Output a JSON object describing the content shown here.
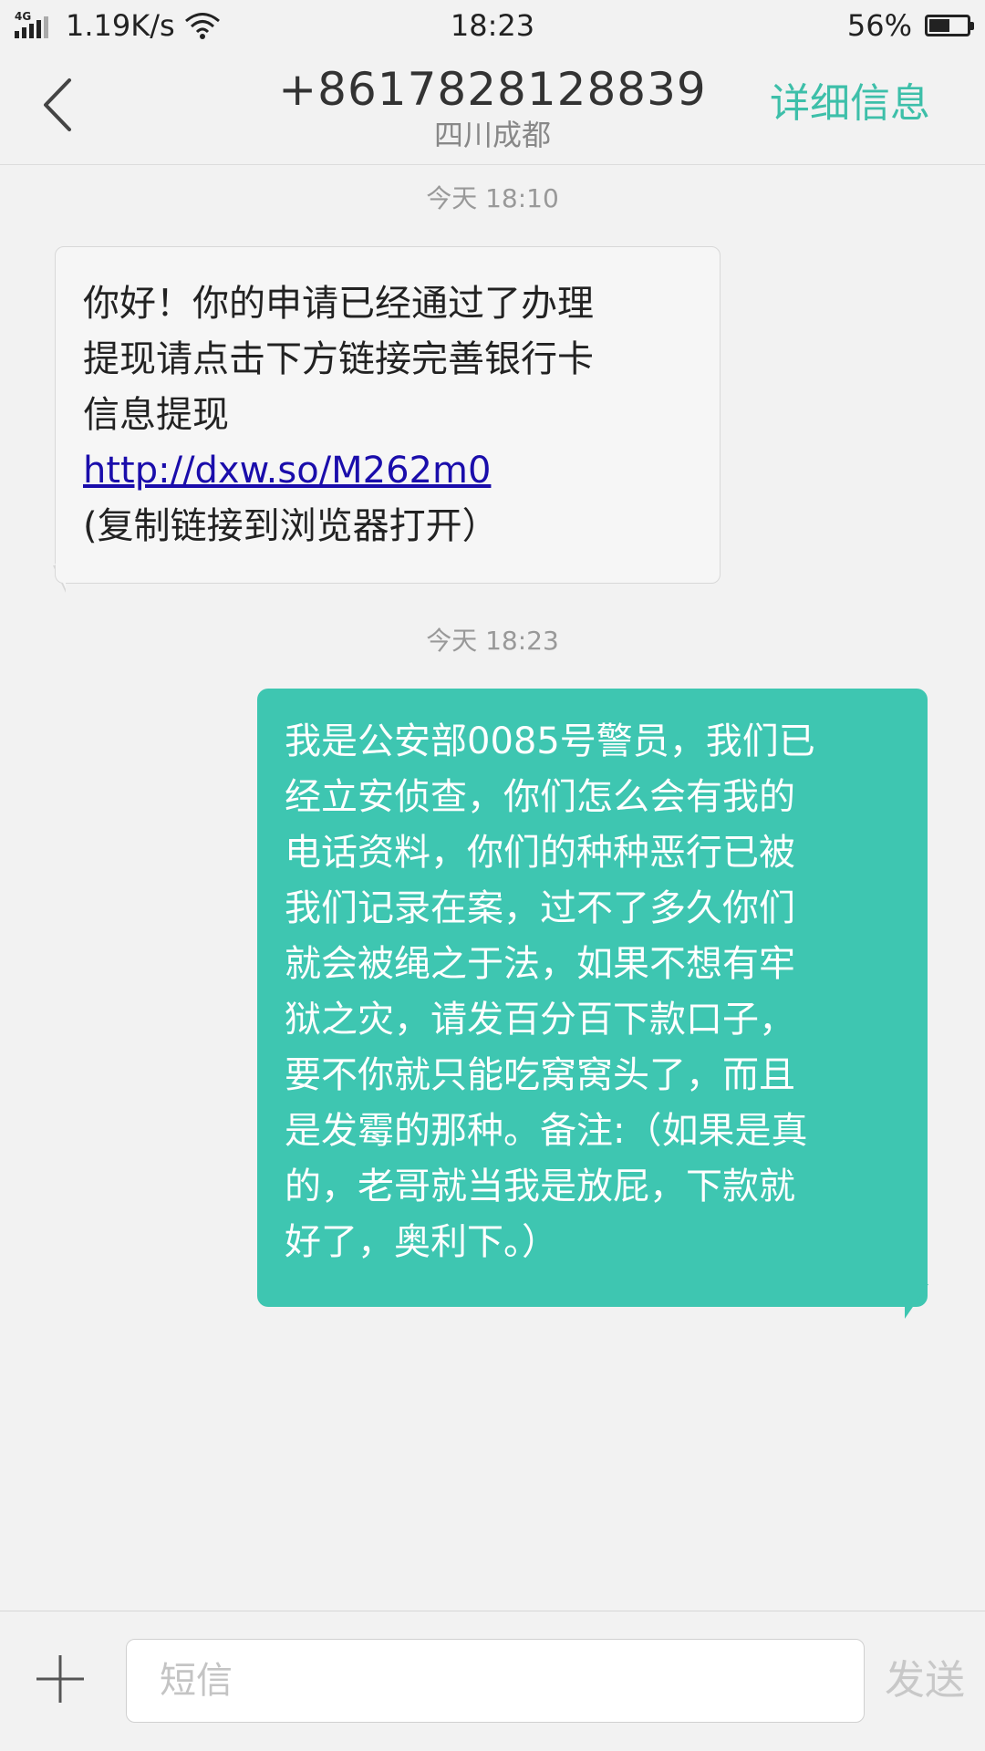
{
  "status_bar": {
    "network_type": "4G",
    "net_speed": "1.19K/s",
    "time": "18:23",
    "battery_percent_text": "56%",
    "battery_level": 0.56
  },
  "header": {
    "contact_number": "+8617828128839",
    "contact_location": "四川成都",
    "details_label": "详细信息"
  },
  "messages": [
    {
      "timestamp": "今天  18:10",
      "direction": "incoming",
      "lines": [
        "你好！你的申请已经通过了办理",
        "提现请点击下方链接完善银行卡",
        "信息提现"
      ],
      "link": "http://dxw.so/M262m0",
      "tail_line": "(复制链接到浏览器打开）"
    },
    {
      "timestamp": "今天  18:23",
      "direction": "outgoing",
      "lines": [
        "我是公安部0085号警员，我们已",
        "经立安侦查，你们怎么会有我的",
        "电话资料，你们的种种恶行已被",
        "我们记录在案，过不了多久你们",
        "就会被绳之于法，如果不想有牢",
        "狱之灾，请发百分百下款口子，",
        "要不你就只能吃窝窝头了，而且",
        "是发霉的那种。备注:（如果是真",
        "的，老哥就当我是放屁，下款就",
        "好了，奥利下。）"
      ]
    }
  ],
  "input_bar": {
    "placeholder": "短信",
    "value": "",
    "send_label": "发送"
  },
  "colors": {
    "accent": "#3dbfa9",
    "outgoing_bubble": "#3ec6b1",
    "incoming_bubble": "#f6f6f6",
    "link": "#1a0dab"
  }
}
